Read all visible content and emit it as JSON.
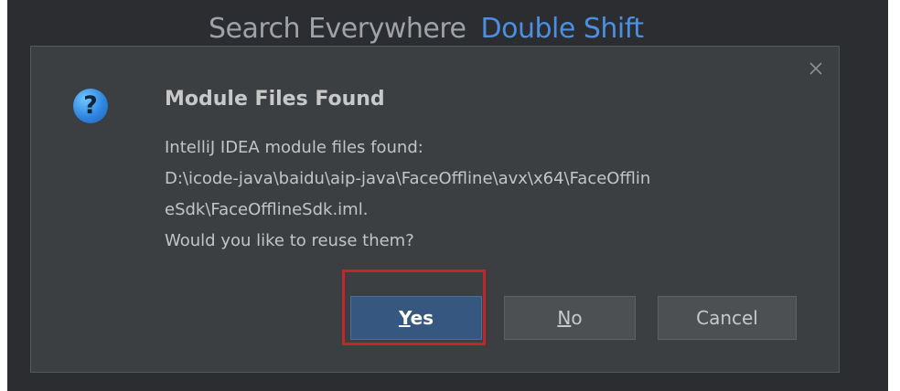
{
  "background_hint": {
    "text": "Search Everywhere",
    "shortcut": "Double Shift"
  },
  "dialog": {
    "icon": "question-icon",
    "icon_glyph": "?",
    "title": "Module Files Found",
    "message_lines": [
      "IntelliJ IDEA module files found:",
      "D:\\icode-java\\baidu\\aip-java\\FaceOffline\\avx\\x64\\FaceOfflin",
      "eSdk\\FaceOfflineSdk.iml.",
      "Would you like to reuse them?"
    ],
    "buttons": {
      "yes": {
        "mnemonic": "Y",
        "rest": "es"
      },
      "no": {
        "mnemonic": "N",
        "rest": "o"
      },
      "cancel": "Cancel"
    },
    "close_icon": "close-icon"
  },
  "colors": {
    "background": "#2b2d30",
    "dialog_bg": "#3c3f41",
    "default_button": "#365880",
    "link": "#4c8fe0",
    "highlight": "#c0262b"
  }
}
